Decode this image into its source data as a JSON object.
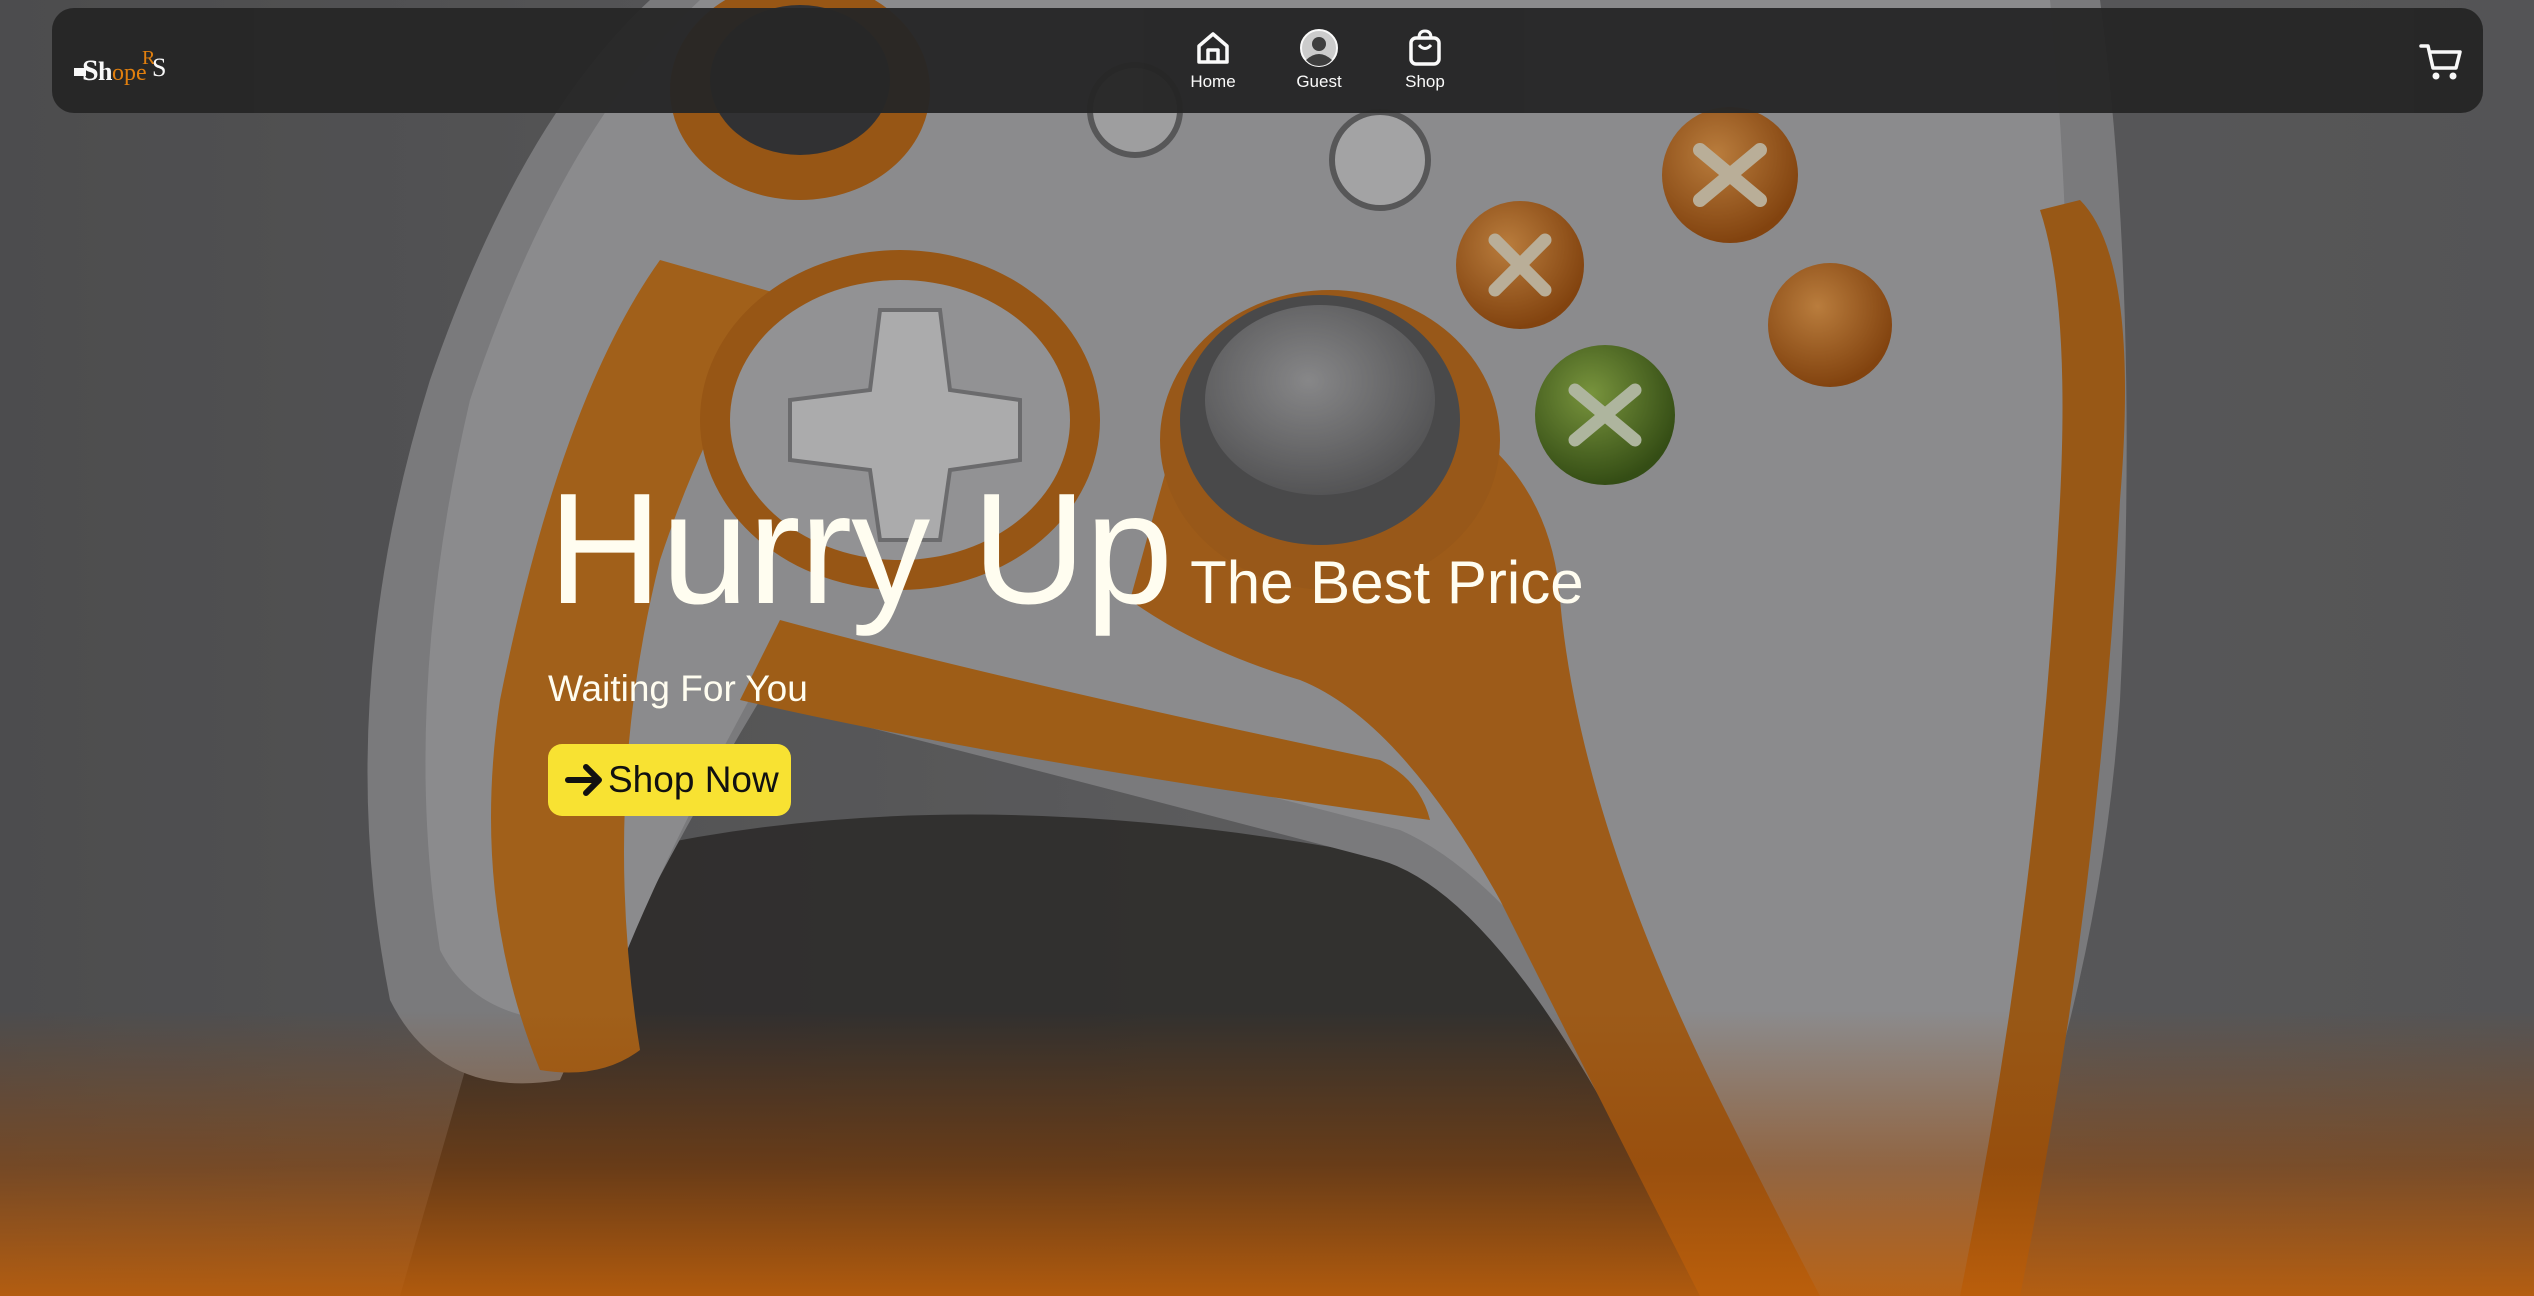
{
  "nav": {
    "logo_alt": "ShopeRS",
    "items": [
      {
        "label": "Home",
        "icon": "home-icon"
      },
      {
        "label": "Guest",
        "icon": "user-avatar-icon"
      },
      {
        "label": "Shop",
        "icon": "shopping-bag-icon"
      }
    ],
    "cart_icon": "cart-icon"
  },
  "hero": {
    "headline": "Hurry Up",
    "subheadline": "The Best Price",
    "tagline": "Waiting For You",
    "button_label": "Shop Now",
    "button_icon": "arrow-right-icon",
    "background": "game-controller-photo"
  },
  "colors": {
    "navbar": "#262626",
    "button": "#f8e232",
    "accent_orange": "#e8820c",
    "text_light": "#fffdf0"
  }
}
